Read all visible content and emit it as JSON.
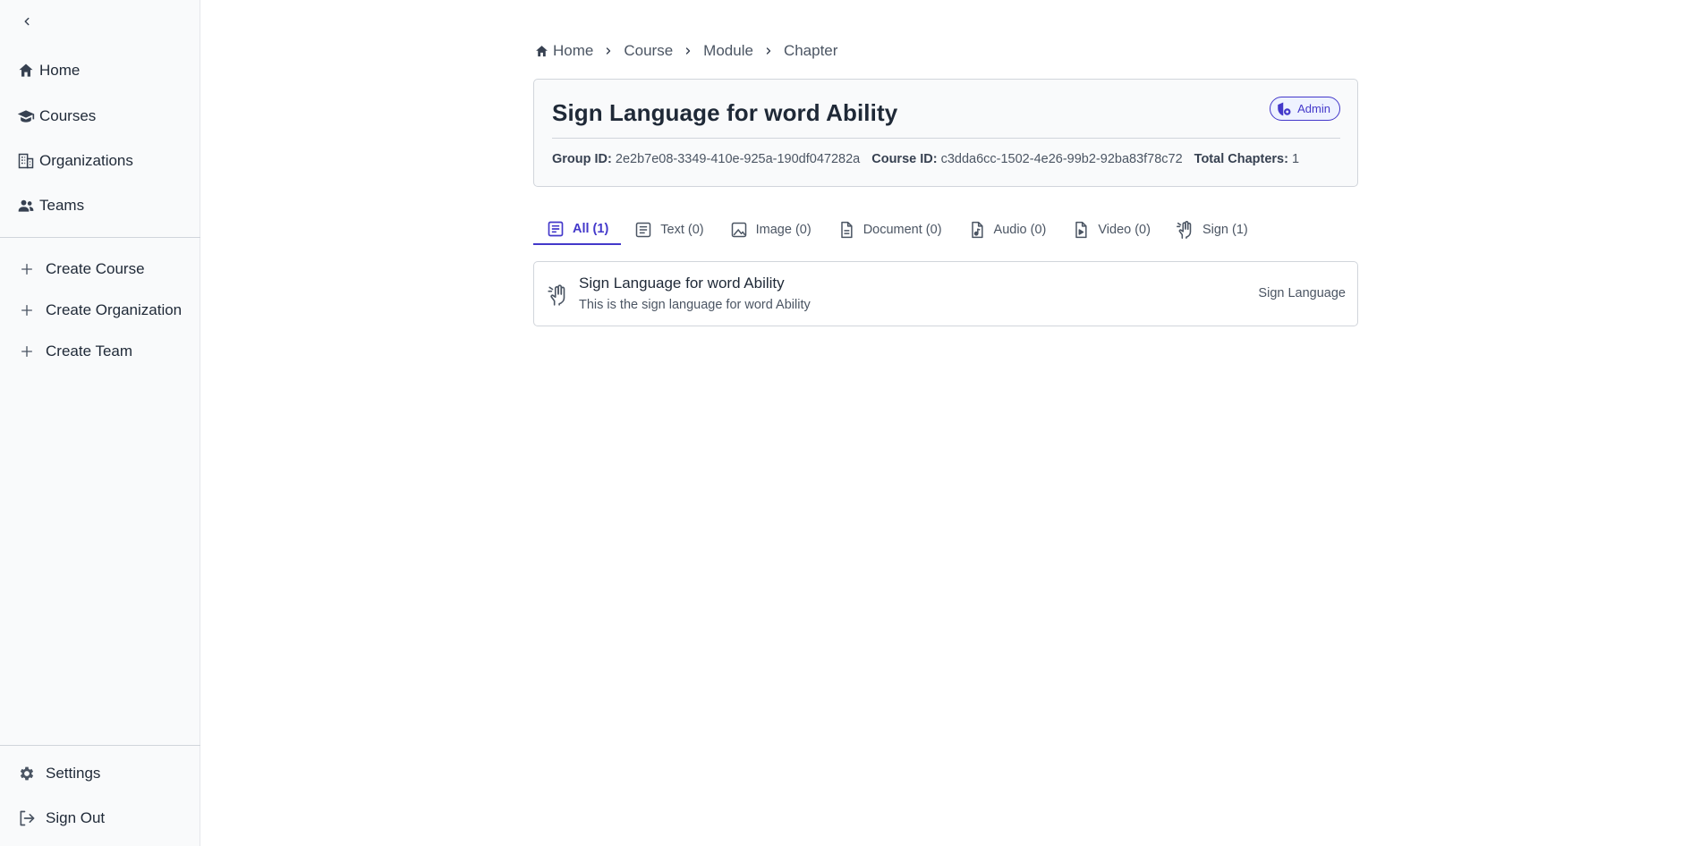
{
  "sidebar": {
    "collapse_icon": "chevron-left-icon",
    "nav": [
      {
        "label": "Home",
        "icon": "home-icon"
      },
      {
        "label": "Courses",
        "icon": "graduation-cap-icon"
      },
      {
        "label": "Organizations",
        "icon": "building-icon"
      },
      {
        "label": "Teams",
        "icon": "users-icon"
      }
    ],
    "actions": [
      {
        "label": "Create Course",
        "icon": "plus-icon"
      },
      {
        "label": "Create Organization",
        "icon": "plus-icon"
      },
      {
        "label": "Create Team",
        "icon": "plus-icon"
      }
    ],
    "footer": [
      {
        "label": "Settings",
        "icon": "gear-icon"
      },
      {
        "label": "Sign Out",
        "icon": "sign-out-icon"
      }
    ]
  },
  "breadcrumb": [
    "Home",
    "Course",
    "Module",
    "Chapter"
  ],
  "header": {
    "title": "Sign Language for word Ability",
    "badge": "Admin",
    "group_id_label": "Group ID:",
    "group_id": "2e2b7e08-3349-410e-925a-190df047282a",
    "course_id_label": "Course ID:",
    "course_id": "c3dda6cc-1502-4e26-99b2-92ba83f78c72",
    "total_chapters_label": "Total Chapters:",
    "total_chapters": "1"
  },
  "tabs": [
    {
      "label": "All (1)",
      "icon": "list-icon",
      "active": true
    },
    {
      "label": "Text (0)",
      "icon": "text-icon",
      "active": false
    },
    {
      "label": "Image (0)",
      "icon": "image-icon",
      "active": false
    },
    {
      "label": "Document (0)",
      "icon": "document-icon",
      "active": false
    },
    {
      "label": "Audio (0)",
      "icon": "audio-file-icon",
      "active": false
    },
    {
      "label": "Video (0)",
      "icon": "video-file-icon",
      "active": false
    },
    {
      "label": "Sign (1)",
      "icon": "sign-hand-icon",
      "active": false
    }
  ],
  "chapters": [
    {
      "title": "Sign Language for word Ability",
      "description": "This is the sign language for word Ability",
      "type": "Sign Language",
      "icon": "sign-hand-icon"
    }
  ],
  "colors": {
    "accent": "#4338ca",
    "sidebar_bg": "#f9fafb",
    "border": "#d1d5db",
    "text": "#1f2937"
  }
}
